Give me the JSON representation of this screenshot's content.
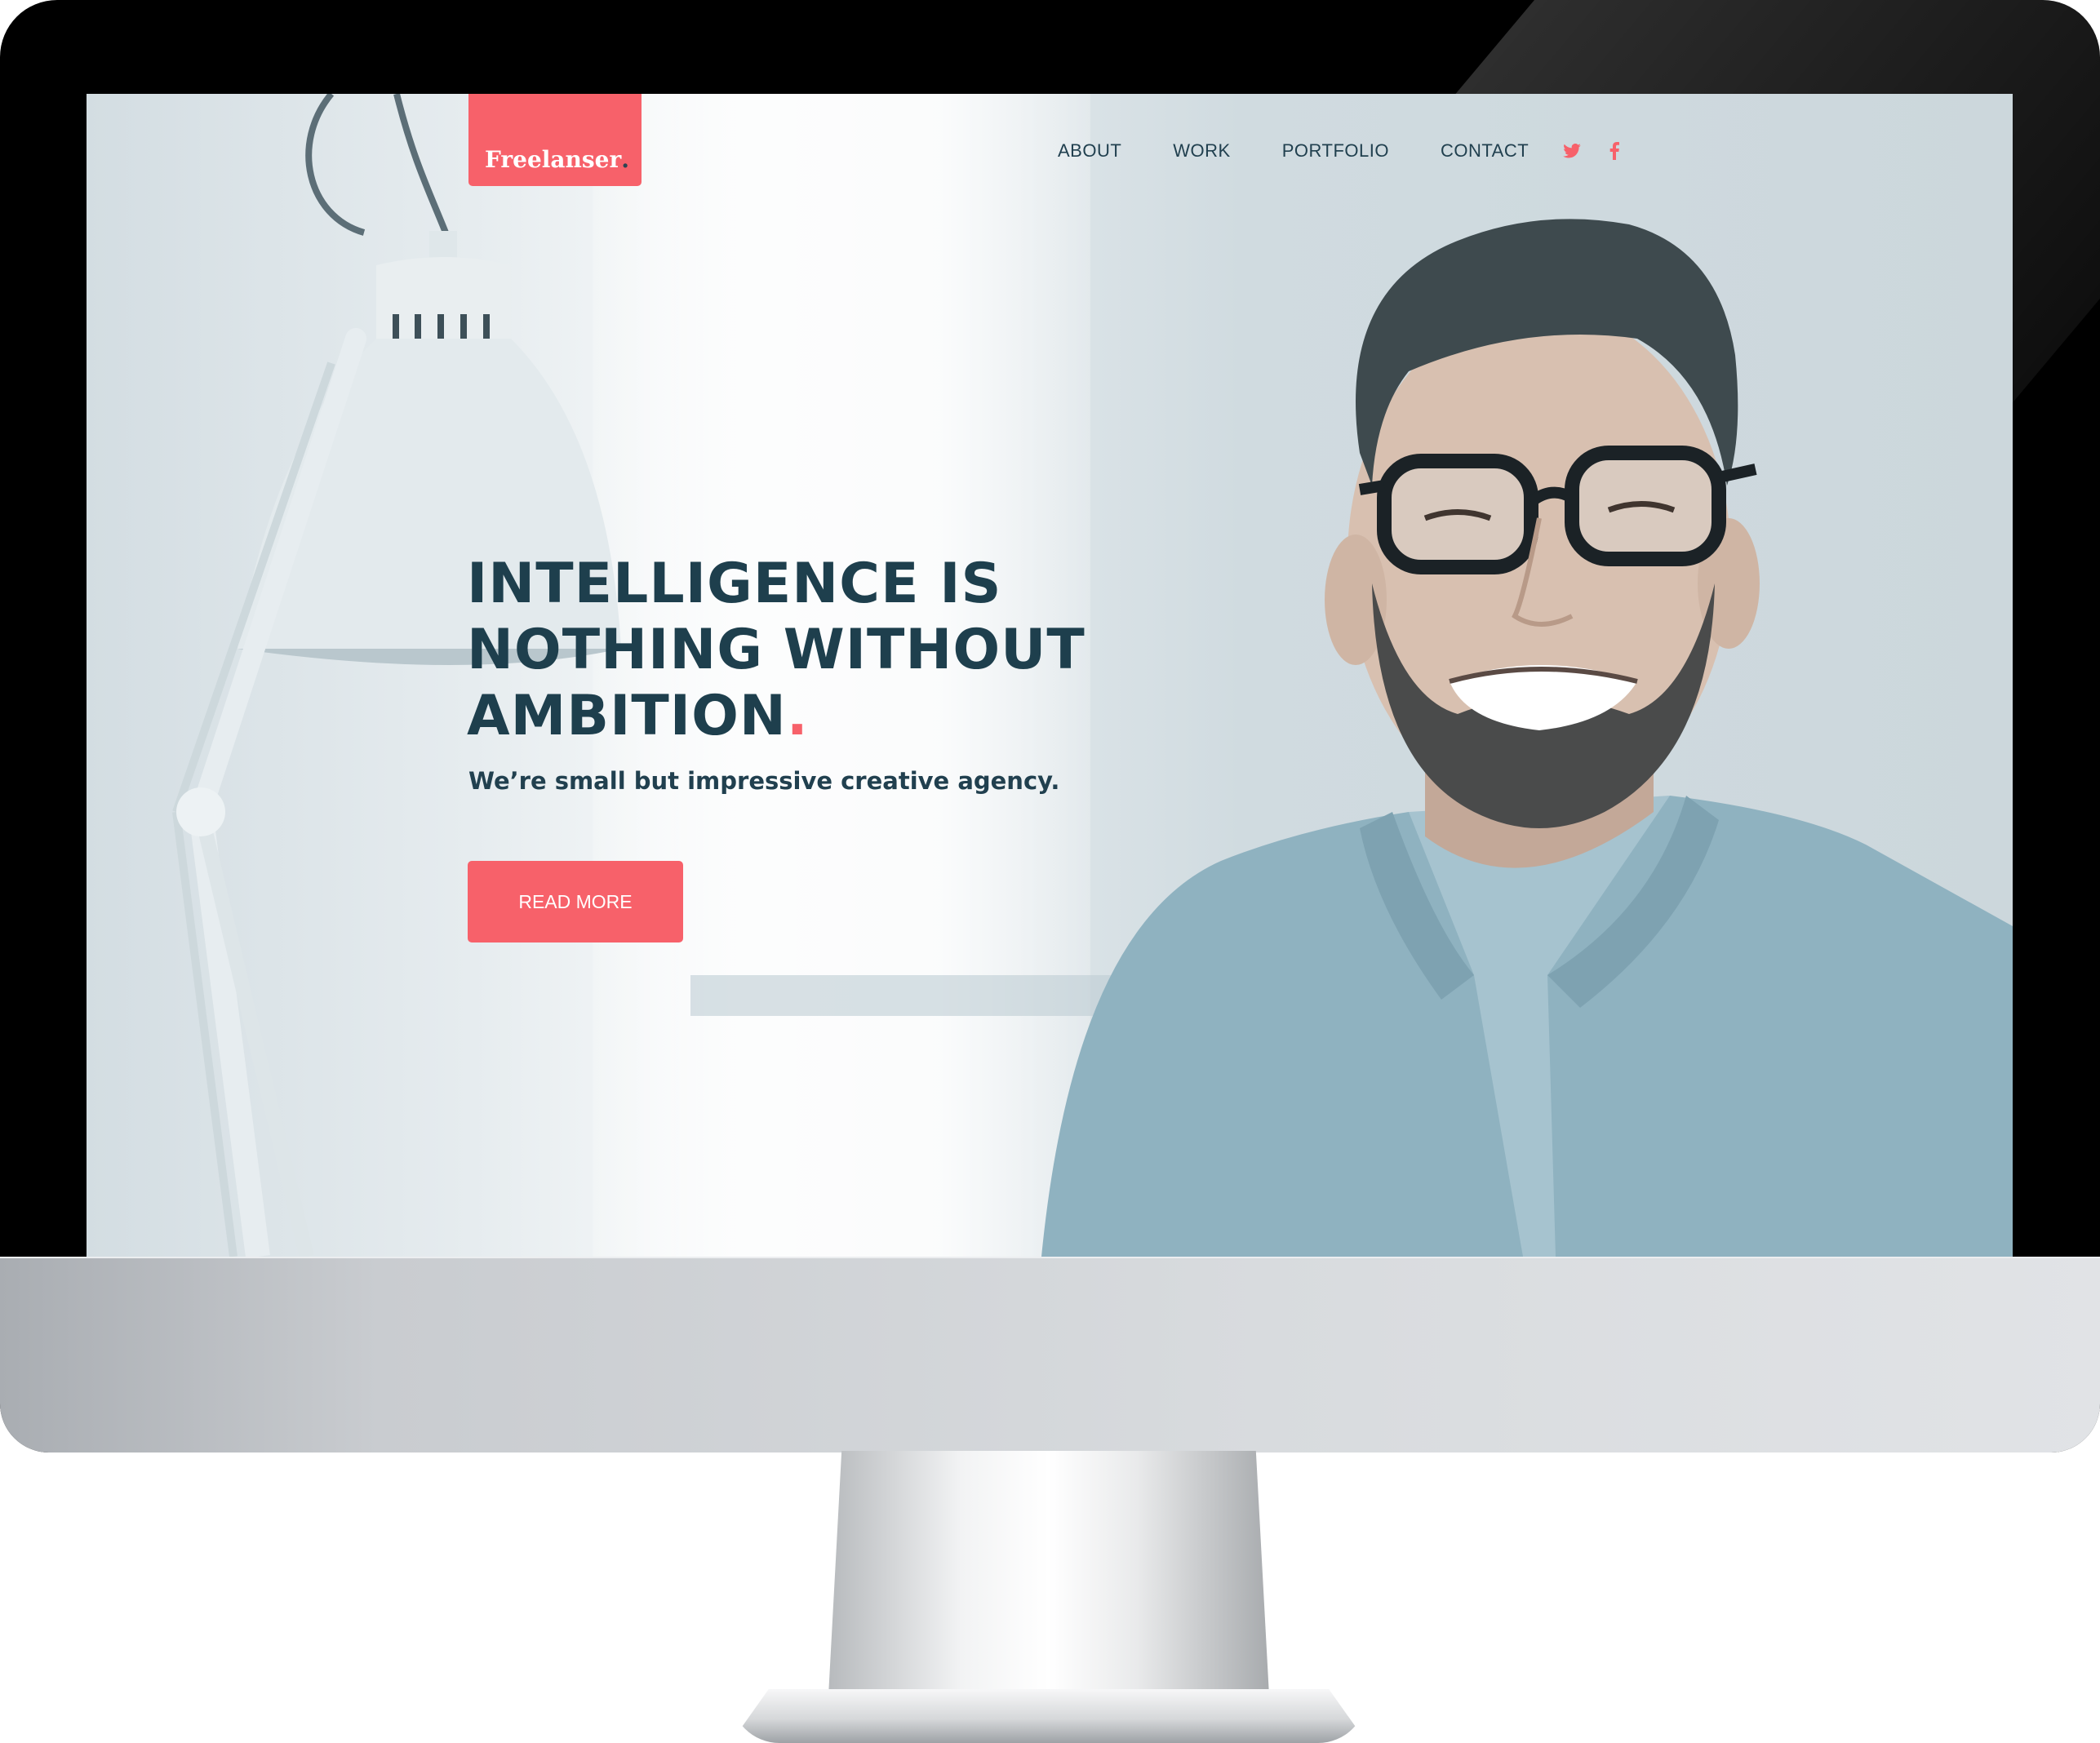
{
  "brand": {
    "name": "Freelanser",
    "suffix": "."
  },
  "nav": {
    "items": [
      {
        "label": "ABOUT"
      },
      {
        "label": "WORK"
      },
      {
        "label": "PORTFOLIO"
      },
      {
        "label": "CONTACT"
      }
    ],
    "social": [
      {
        "icon": "twitter-icon"
      },
      {
        "icon": "facebook-icon"
      }
    ]
  },
  "hero": {
    "title_lines": [
      "INTELLIGENCE IS",
      "NOTHING WITHOUT",
      "AMBITION"
    ],
    "title_accent": ".",
    "subtitle": "We’re small but impressive creative agency.",
    "cta_label": "READ MORE"
  },
  "colors": {
    "accent": "#f7616a",
    "heading": "#1e3f4d",
    "bezel": "#000000"
  }
}
